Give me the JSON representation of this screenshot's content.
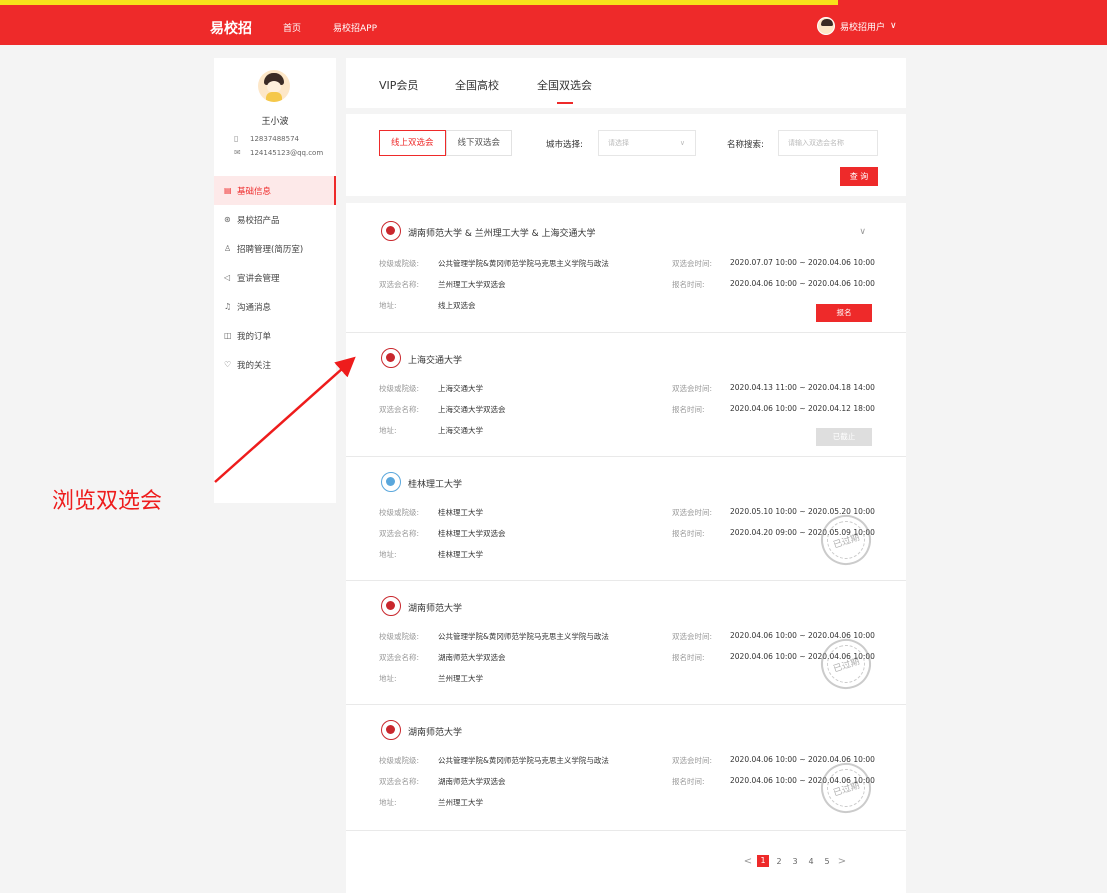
{
  "navbar": {
    "logo": "易校招",
    "links": [
      "首页",
      "易校招APP"
    ],
    "user": "易校招用户",
    "user_chevron": "∨"
  },
  "sidebar": {
    "name": "王小波",
    "phone": "12837488574",
    "email": "124145123@qq.com",
    "items": [
      {
        "label": "基础信息",
        "icon": "document-icon",
        "active": true
      },
      {
        "label": "易校招产品",
        "icon": "box-icon"
      },
      {
        "label": "招聘管理(简历室)",
        "icon": "user-icon"
      },
      {
        "label": "宣讲会管理",
        "icon": "speaker-icon"
      },
      {
        "label": "沟通消息",
        "icon": "bell-icon"
      },
      {
        "label": "我的订单",
        "icon": "order-icon"
      },
      {
        "label": "我的关注",
        "icon": "heart-icon"
      }
    ]
  },
  "tabs": [
    "VIP会员",
    "全国高校",
    "全国双选会"
  ],
  "active_tab": 2,
  "filter": {
    "online": "线上双选会",
    "offline": "线下双选会",
    "city_label": "城市选择:",
    "city_placeholder": "请选择",
    "name_label": "名称搜索:",
    "name_placeholder": "请输入双选会名称",
    "query_button": "查 询"
  },
  "labels": {
    "school": "校级或院级:",
    "fair_name": "双选会名称:",
    "address": "地址:",
    "fair_time": "双选会时间:",
    "signup_time": "报名时间:"
  },
  "cards": [
    {
      "name": "湖南师范大学 & 兰州理工大学 & 上海交通大学",
      "school": "公共管理学院&黄冈师范学院马克思主义学院与政法",
      "fair_name": "兰州理工大学双选会",
      "address": "线上双选会",
      "fair_time": "2020.07.07 10:00 ~ 2020.04.06 10:00",
      "signup_time": "2020.04.06 10:00 ~ 2020.04.06 10:00",
      "button": "报名",
      "state": "open",
      "expandable": true
    },
    {
      "name": "上海交通大学",
      "school": "上海交通大学",
      "fair_name": "上海交通大学双选会",
      "address": "上海交通大学",
      "fair_time": "2020.04.13 11:00 ~ 2020.04.18 14:00",
      "signup_time": "2020.04.06 10:00 ~ 2020.04.12 18:00",
      "button": "已截止",
      "state": "closed"
    },
    {
      "name": "桂林理工大学",
      "school": "桂林理工大学",
      "fair_name": "桂林理工大学双选会",
      "address": "桂林理工大学",
      "fair_time": "2020.05.10 10:00 ~ 2020.05.20 10:00",
      "signup_time": "2020.04.20 09:00 ~ 2020.05.09 10:00",
      "stamp": "已过期",
      "state": "expired"
    },
    {
      "name": "湖南师范大学",
      "school": "公共管理学院&黄冈师范学院马克思主义学院与政法",
      "fair_name": "湖南师范大学双选会",
      "address": "兰州理工大学",
      "fair_time": "2020.04.06 10:00 ~ 2020.04.06 10:00",
      "signup_time": "2020.04.06 10:00 ~ 2020.04.06 10:00",
      "stamp": "已过期",
      "state": "expired"
    },
    {
      "name": "湖南师范大学",
      "school": "公共管理学院&黄冈师范学院马克思主义学院与政法",
      "fair_name": "湖南师范大学双选会",
      "address": "兰州理工大学",
      "fair_time": "2020.04.06 10:00 ~ 2020.04.06 10:00",
      "signup_time": "2020.04.06 10:00 ~ 2020.04.06 10:00",
      "stamp": "已过期",
      "state": "expired"
    }
  ],
  "pagination": {
    "pages": [
      "1",
      "2",
      "3",
      "4",
      "5"
    ],
    "current": "1",
    "prev": "<",
    "next": ">"
  },
  "annotation": "浏览双选会",
  "colors": {
    "brand": "#ee2a2a",
    "highlight": "#f7e11b"
  }
}
